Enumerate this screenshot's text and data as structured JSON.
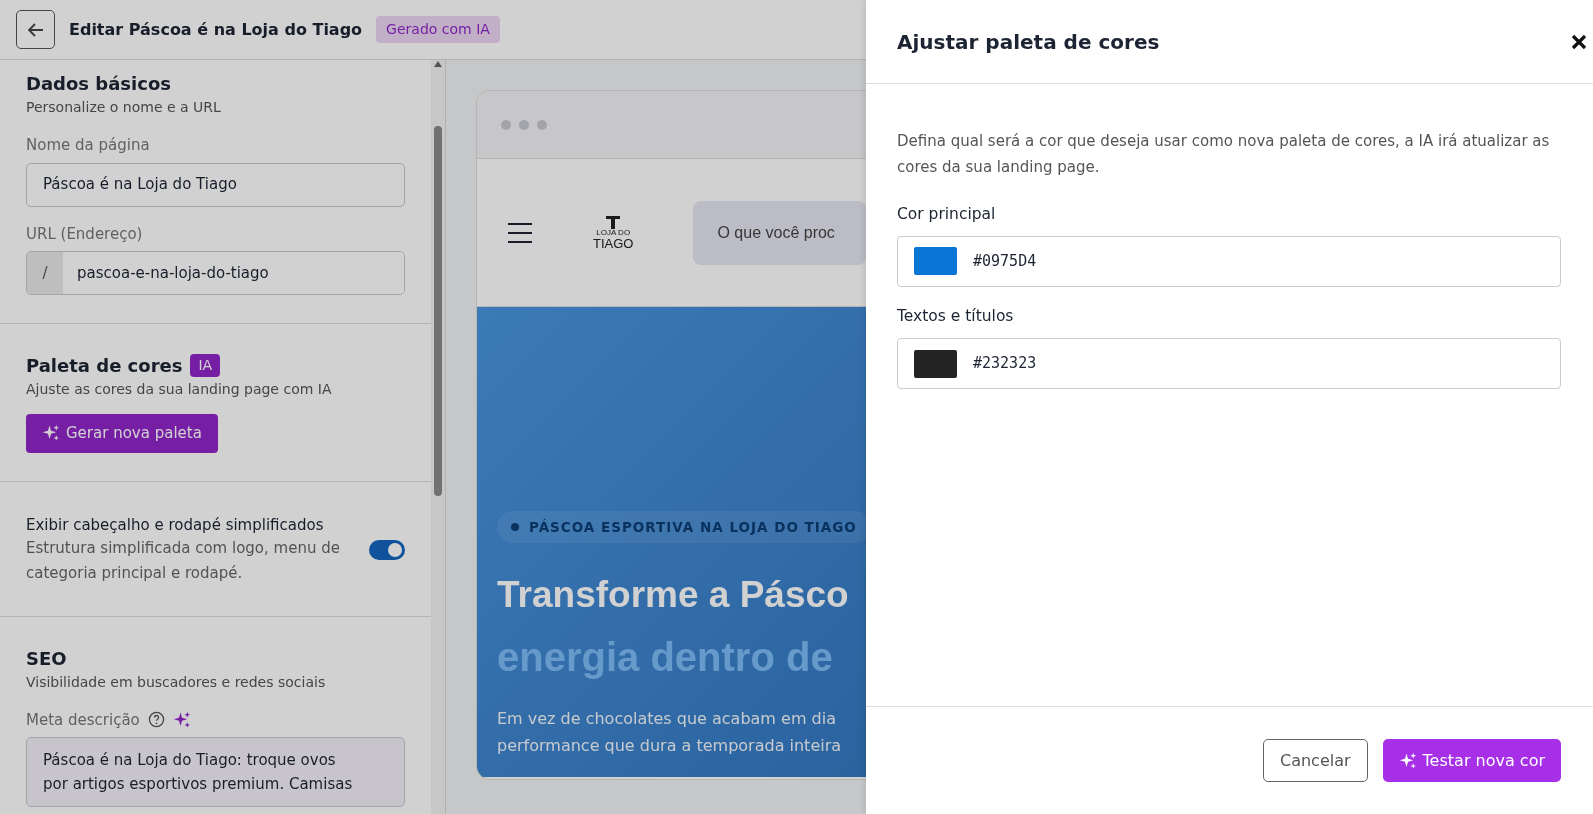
{
  "header": {
    "title": "Editar Páscoa é na Loja do Tiago",
    "badge": "Gerado com IA"
  },
  "sidebar": {
    "basic": {
      "title": "Dados básicos",
      "subtitle": "Personalize o nome e a URL",
      "name_label": "Nome da página",
      "name_value": "Páscoa é na Loja do Tiago",
      "url_label": "URL (Endereço)",
      "url_prefix": "/",
      "url_value": "pascoa-e-na-loja-do-tiago"
    },
    "palette": {
      "title": "Paleta de cores",
      "badge": "IA",
      "subtitle": "Ajuste as cores da sua landing page com IA",
      "button": "Gerar nova paleta"
    },
    "simplified": {
      "title": "Exibir cabeçalho e rodapé simplificados",
      "description": "Estrutura simplificada com logo, menu de categoria principal e rodapé.",
      "on": true
    },
    "seo": {
      "title": "SEO",
      "subtitle": "Visibilidade em buscadores e redes sociais",
      "meta_label": "Meta descrição",
      "meta_value": "Páscoa é na Loja do Tiago: troque ovos por artigos esportivos premium. Camisas"
    }
  },
  "preview": {
    "logo_top": "LOJA DO",
    "logo_bottom": "TIAGO",
    "search_placeholder": "O que você proc",
    "hero_tag": "PÁSCOA ESPORTIVA NA LOJA DO TIAGO",
    "hero_title_1": "Transforme a Pásco",
    "hero_title_2": "energia dentro de",
    "hero_text_1": "Em vez de chocolates que acabam em dia",
    "hero_text_2": "performance que dura a temporada inteira"
  },
  "drawer": {
    "title": "Ajustar paleta de cores",
    "description": "Defina qual será a cor que deseja usar como nova paleta de cores, a IA irá atualizar as cores da sua landing page.",
    "colors": [
      {
        "label": "Cor principal",
        "value": "#0975D4",
        "color": "#0975d4"
      },
      {
        "label": "Textos e títulos",
        "value": "#232323",
        "color": "#232323"
      }
    ],
    "buttons": [
      {
        "kind": "secondary",
        "label": "Cancelar"
      },
      {
        "kind": "primary",
        "label": "Testar nova cor"
      }
    ]
  }
}
